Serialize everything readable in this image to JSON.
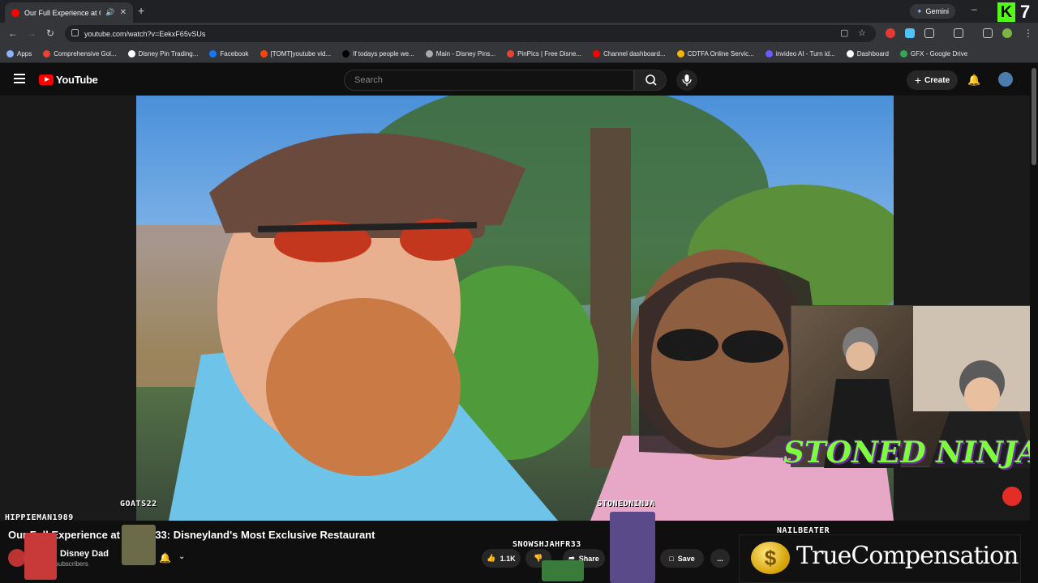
{
  "browser": {
    "tab_title": "Our Full Experience at CLUB",
    "new_tab": "+",
    "gemini_label": "Gemini",
    "overlay_number": "7",
    "url": "youtube.com/watch?v=EekxF65vSUs"
  },
  "bookmarks": [
    {
      "label": "Apps",
      "color": "#8ab4f8"
    },
    {
      "label": "Comprehensive Gol...",
      "color": "#e94235"
    },
    {
      "label": "Disney Pin Trading...",
      "color": "#ffffff"
    },
    {
      "label": "Facebook",
      "color": "#1877f2"
    },
    {
      "label": "[TOMT]youtube vid...",
      "color": "#ff4500"
    },
    {
      "label": "If todays people we...",
      "color": "#000000"
    },
    {
      "label": "Main - Disney Pins...",
      "color": "#aaaaaa"
    },
    {
      "label": "PinPics | Free Disne...",
      "color": "#e94235"
    },
    {
      "label": "Channel dashboard...",
      "color": "#ff0000"
    },
    {
      "label": "CDTFA Online Servic...",
      "color": "#f4b400"
    },
    {
      "label": "invideo AI - Turn id...",
      "color": "#6b5cff"
    },
    {
      "label": "Dashboard",
      "color": "#ffffff"
    },
    {
      "label": "GFX - Google Drive",
      "color": "#34a853"
    }
  ],
  "youtube": {
    "logo_text": "YouTube",
    "search_placeholder": "Search",
    "create_label": "Create"
  },
  "stream_overlay": {
    "banner": "STONED NINJA",
    "names": [
      "GOATS22",
      "STONEDNINJA",
      "HIPPIEMAN1989",
      "SNOWSHJAHFR33",
      "NAILBEATER"
    ],
    "sponsor": "TrueCompensation",
    "coin_symbol": "$"
  },
  "video": {
    "title": "Our Full Experience at CLUB 33: Disneyland's Most Exclusive Restaurant",
    "channel_name": "Disney Dad",
    "subscribers": "subscribers",
    "likes": "1.1K",
    "share_label": "Share",
    "save_label": "Save",
    "more": "..."
  }
}
